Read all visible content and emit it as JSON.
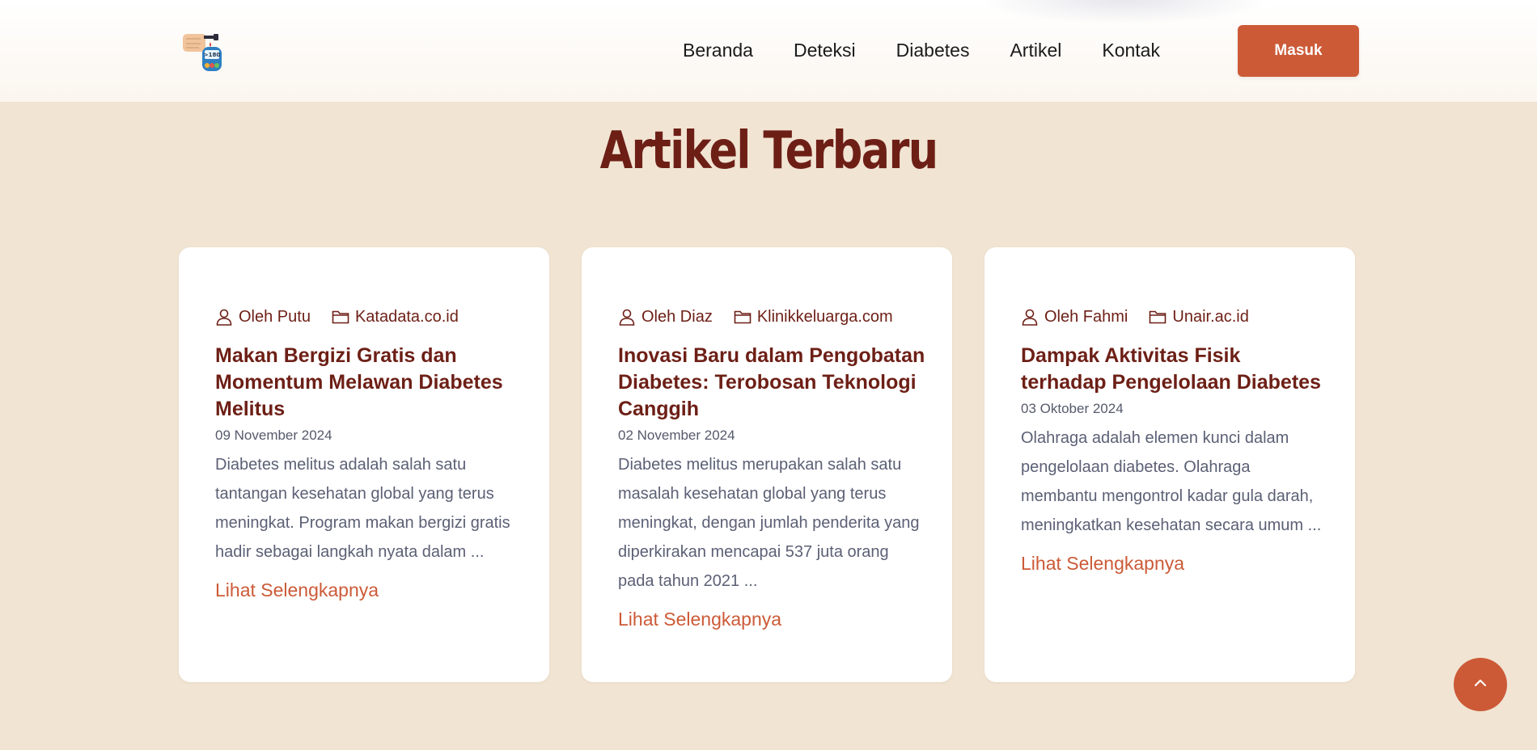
{
  "header": {
    "nav": [
      "Beranda",
      "Deteksi",
      "Diabetes",
      "Artikel",
      "Kontak"
    ],
    "login_label": "Masuk",
    "logo_icon": "glucose-meter-logo-icon"
  },
  "section": {
    "title": "Artikel Terbaru"
  },
  "articles": [
    {
      "author": "Oleh Putu",
      "source": "Katadata.co.id",
      "title": "Makan Bergizi Gratis dan Momentum Melawan Diabetes Melitus",
      "date": "09 November 2024",
      "excerpt": "Diabetes melitus adalah salah satu tantangan kesehatan global yang terus meningkat. Program makan bergizi gratis hadir sebagai langkah nyata dalam ...",
      "link": "Lihat Selengkapnya"
    },
    {
      "author": "Oleh Diaz",
      "source": "Klinikkeluarga.com",
      "title": "Inovasi Baru dalam Pengobatan Diabetes: Terobosan Teknologi Canggih",
      "date": "02 November 2024",
      "excerpt": "Diabetes melitus merupakan salah satu masalah kesehatan global yang terus meningkat, dengan jumlah penderita yang diperkirakan mencapai 537 juta orang pada tahun 2021 ...",
      "link": "Lihat Selengkapnya"
    },
    {
      "author": "Oleh Fahmi",
      "source": "Unair.ac.id",
      "title": "Dampak Aktivitas Fisik terhadap Pengelolaan Diabetes",
      "date": "03 Oktober 2024",
      "excerpt": "Olahraga adalah elemen kunci dalam pengelolaan diabetes. Olahraga membantu mengontrol kadar gula darah, meningkatkan kesehatan secara umum ...",
      "link": "Lihat Selengkapnya"
    }
  ],
  "colors": {
    "background": "#f1e4d3",
    "accent": "#cc5a37",
    "title": "#6d1f16",
    "body_text": "#5b6075"
  }
}
